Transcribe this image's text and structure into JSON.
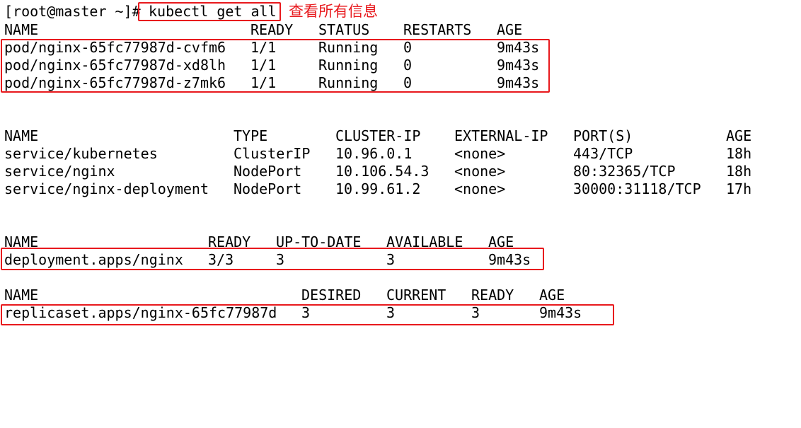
{
  "prompt": {
    "text": "[root@master ~]#",
    "command": "kubectl get all"
  },
  "annotation": "查看所有信息",
  "pods": {
    "headers": [
      "NAME",
      "READY",
      "STATUS",
      "RESTARTS",
      "AGE"
    ],
    "rows": [
      [
        "pod/nginx-65fc77987d-cvfm6",
        "1/1",
        "Running",
        "0",
        "9m43s"
      ],
      [
        "pod/nginx-65fc77987d-xd8lh",
        "1/1",
        "Running",
        "0",
        "9m43s"
      ],
      [
        "pod/nginx-65fc77987d-z7mk6",
        "1/1",
        "Running",
        "0",
        "9m43s"
      ]
    ]
  },
  "services": {
    "headers": [
      "NAME",
      "TYPE",
      "CLUSTER-IP",
      "EXTERNAL-IP",
      "PORT(S)",
      "AGE"
    ],
    "rows": [
      [
        "service/kubernetes",
        "ClusterIP",
        "10.96.0.1",
        "<none>",
        "443/TCP",
        "18h"
      ],
      [
        "service/nginx",
        "NodePort",
        "10.106.54.3",
        "<none>",
        "80:32365/TCP",
        "18h"
      ],
      [
        "service/nginx-deployment",
        "NodePort",
        "10.99.61.2",
        "<none>",
        "30000:31118/TCP",
        "17h"
      ]
    ]
  },
  "deployments": {
    "headers": [
      "NAME",
      "READY",
      "UP-TO-DATE",
      "AVAILABLE",
      "AGE"
    ],
    "rows": [
      [
        "deployment.apps/nginx",
        "3/3",
        "3",
        "3",
        "9m43s"
      ]
    ]
  },
  "replicasets": {
    "headers": [
      "NAME",
      "DESIRED",
      "CURRENT",
      "READY",
      "AGE"
    ],
    "rows": [
      [
        "replicaset.apps/nginx-65fc77987d",
        "3",
        "3",
        "3",
        "9m43s"
      ]
    ]
  },
  "colors": {
    "highlight": "#e8191d",
    "text": "#000000",
    "background": "#ffffff"
  }
}
